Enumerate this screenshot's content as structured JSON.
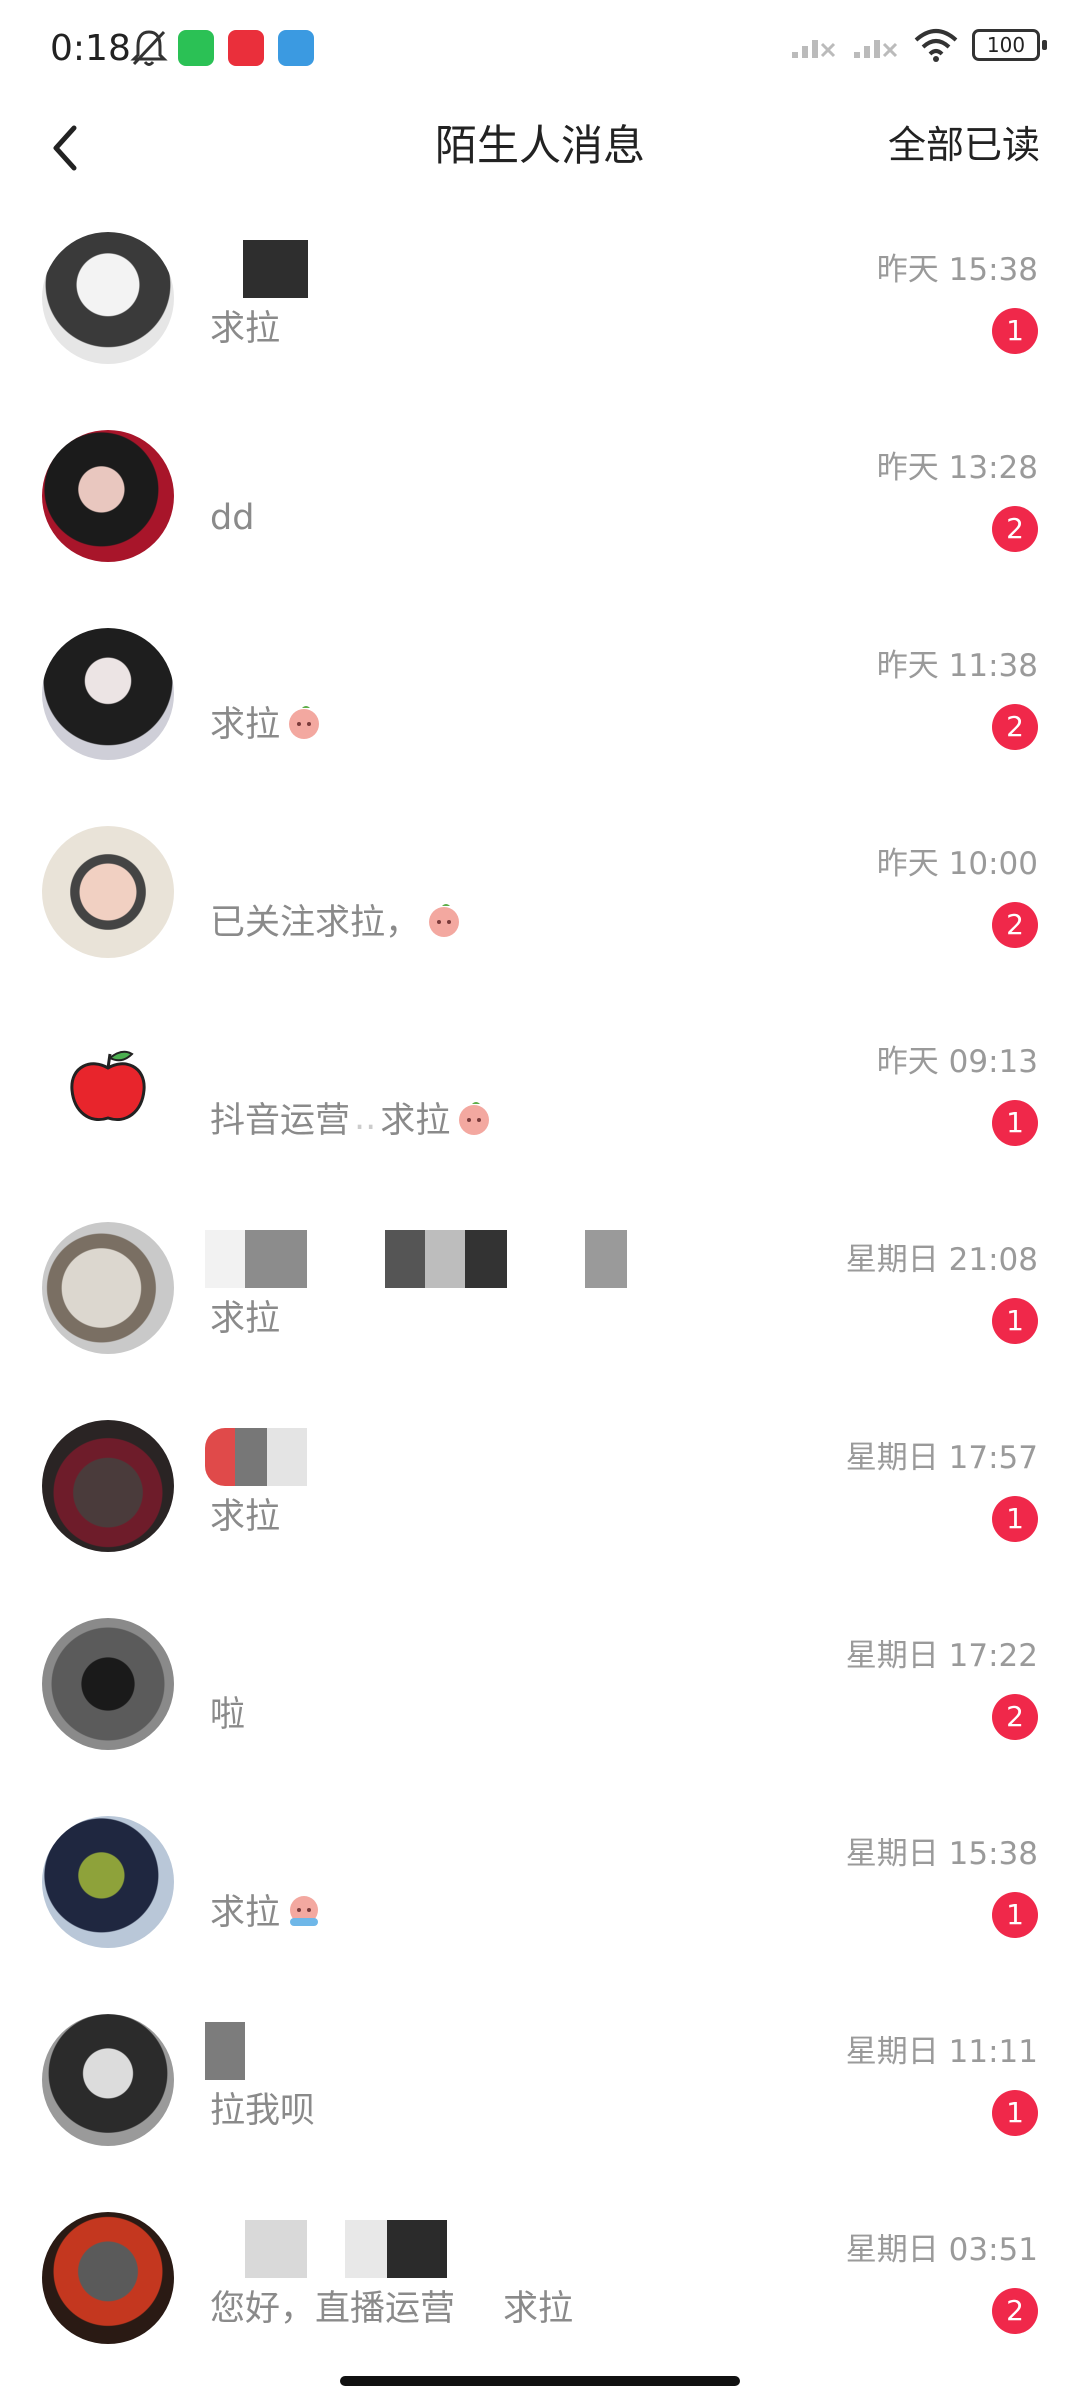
{
  "status_bar": {
    "time": "0:18",
    "icons": [
      "mute-bell-icon",
      "wechat-icon",
      "xiaohongshu-icon",
      "upload-icon",
      "signal-icon",
      "signal-icon",
      "wifi-icon"
    ],
    "battery": "100"
  },
  "header": {
    "back_icon": "chevron-left-icon",
    "title": "陌生人消息",
    "mark_all_read": "全部已读"
  },
  "messages": [
    {
      "preview": "求拉",
      "time": "昨天 15:38",
      "unread": "1"
    },
    {
      "preview": "dd",
      "time": "昨天 13:28",
      "unread": "2"
    },
    {
      "preview": "求拉",
      "time": "昨天 11:38",
      "unread": "2"
    },
    {
      "preview": "已关注求拉，",
      "time": "昨天 10:00",
      "unread": "2"
    },
    {
      "preview": "抖音运营",
      "preview2": "求拉",
      "time": "昨天 09:13",
      "unread": "1"
    },
    {
      "preview": "求拉",
      "time": "星期日 21:08",
      "unread": "1"
    },
    {
      "preview": "求拉",
      "time": "星期日 17:57",
      "unread": "1"
    },
    {
      "preview": "啦",
      "time": "星期日 17:22",
      "unread": "2"
    },
    {
      "preview": "求拉",
      "time": "星期日 15:38",
      "unread": "1"
    },
    {
      "preview": "拉我呗",
      "time": "星期日 11:11",
      "unread": "1"
    },
    {
      "preview": "您好，直播运营",
      "preview2": "求拉",
      "time": "星期日 03:51",
      "unread": "2"
    }
  ],
  "colors": {
    "badge": "#f0284a",
    "secondary_text": "#8a8a8a"
  }
}
